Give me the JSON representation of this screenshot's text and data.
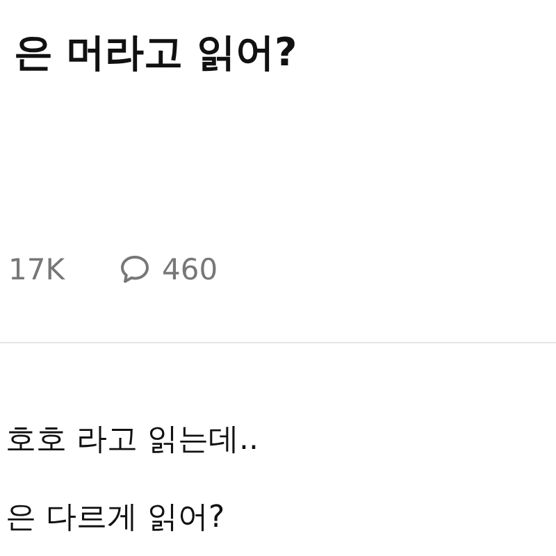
{
  "post": {
    "title": "은 머라고 읽어?",
    "views": "17K",
    "comments": "460"
  },
  "body": {
    "lines": [
      "호호 라고 읽는데..",
      "은 다르게 읽어?"
    ]
  }
}
